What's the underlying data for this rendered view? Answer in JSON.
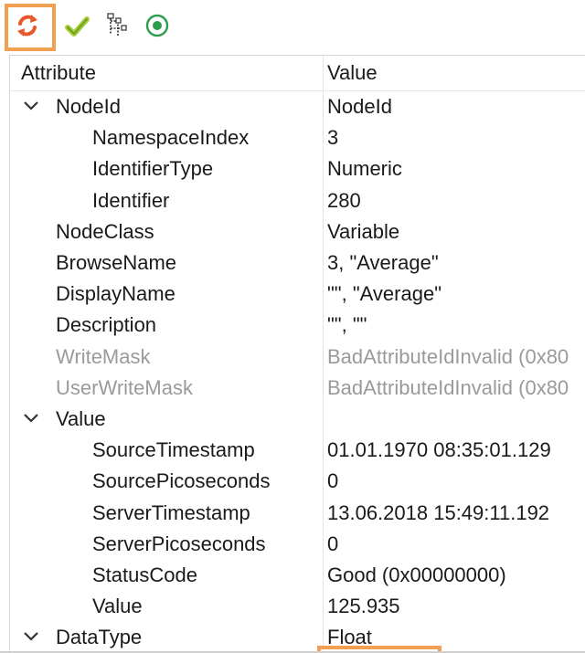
{
  "toolbar": {
    "buttons": [
      {
        "name": "refresh",
        "icon": "refresh-icon"
      },
      {
        "name": "check",
        "icon": "check-icon"
      },
      {
        "name": "tree",
        "icon": "tree-icon"
      },
      {
        "name": "record",
        "icon": "record-icon"
      }
    ],
    "highlight_color": "#f0a050"
  },
  "table": {
    "headers": {
      "attribute": "Attribute",
      "value": "Value"
    },
    "rows": [
      {
        "attribute": "NodeId",
        "value": "NodeId",
        "indent": 0,
        "expandable": true,
        "expanded": true
      },
      {
        "attribute": "NamespaceIndex",
        "value": "3",
        "indent": 1
      },
      {
        "attribute": "IdentifierType",
        "value": "Numeric",
        "indent": 1
      },
      {
        "attribute": "Identifier",
        "value": "280",
        "indent": 1
      },
      {
        "attribute": "NodeClass",
        "value": "Variable",
        "indent": 0
      },
      {
        "attribute": "BrowseName",
        "value": "3, \"Average\"",
        "indent": 0
      },
      {
        "attribute": "DisplayName",
        "value": "\"\", \"Average\"",
        "indent": 0
      },
      {
        "attribute": "Description",
        "value": "\"\", \"\"",
        "indent": 0
      },
      {
        "attribute": "WriteMask",
        "value": "BadAttributeIdInvalid (0x80",
        "indent": 0,
        "muted": true
      },
      {
        "attribute": "UserWriteMask",
        "value": "BadAttributeIdInvalid (0x80",
        "indent": 0,
        "muted": true
      },
      {
        "attribute": "Value",
        "value": "",
        "indent": 0,
        "expandable": true,
        "expanded": true
      },
      {
        "attribute": "SourceTimestamp",
        "value": "01.01.1970 08:35:01.129",
        "indent": 1
      },
      {
        "attribute": "SourcePicoseconds",
        "value": "0",
        "indent": 1
      },
      {
        "attribute": "ServerTimestamp",
        "value": "13.06.2018 15:49:11.192",
        "indent": 1
      },
      {
        "attribute": "ServerPicoseconds",
        "value": "0",
        "indent": 1
      },
      {
        "attribute": "StatusCode",
        "value": "Good (0x00000000)",
        "indent": 1
      },
      {
        "attribute": "Value",
        "value": "125.935",
        "indent": 1,
        "highlighted": true
      },
      {
        "attribute": "DataType",
        "value": "Float",
        "indent": 0,
        "expandable": true,
        "expanded": true
      }
    ]
  }
}
